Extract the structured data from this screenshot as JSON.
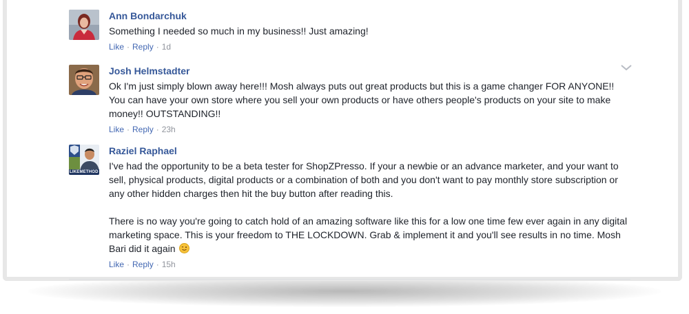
{
  "comments": [
    {
      "author": "Ann Bondarchuk",
      "paragraphs": [
        "Something I needed so much in my business!! Just amazing!"
      ],
      "like_label": "Like",
      "reply_label": "Reply",
      "time": "1d",
      "avatar": "profile-photo-woman"
    },
    {
      "author": "Josh Helmstadter",
      "paragraphs": [
        "Ok I'm just simply blown away here!!! Mosh always puts out great products but this is a game changer FOR ANYONE!! You can have your own store where you sell your own products or have others people's products on your site to make money!! OUTSTANDING!!"
      ],
      "like_label": "Like",
      "reply_label": "Reply",
      "time": "23h",
      "avatar": "profile-photo-man"
    },
    {
      "author": "Raziel Raphael",
      "paragraphs": [
        "I've had the opportunity to be a beta tester for ShopZPresso. If your a newbie or an advance marketer, and your want to sell, physical products, digital products or a combination of both and you don't want to pay monthly store subscription or any other hidden charges then hit the buy button after reading this.",
        "There is no way you're going to catch hold of an amazing software like this for a low one time few ever again in any digital marketing space. This is your freedom to THE LOCKDOWN. Grab & implement it and you'll see results in no time. Mosh Bari did it again"
      ],
      "like_label": "Like",
      "reply_label": "Reply",
      "time": "15h",
      "avatar": "profile-photo-likemethod",
      "avatar_badge": "LIKEMETHOD",
      "emoji": "winking-face-emoji"
    }
  ],
  "separator": "·",
  "menu_icon": "chevron-down-icon"
}
